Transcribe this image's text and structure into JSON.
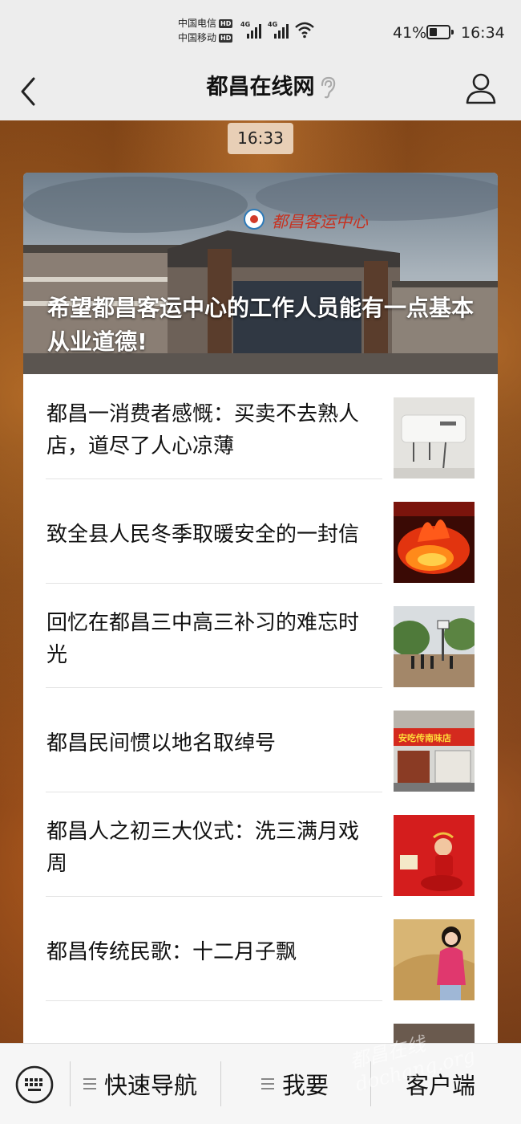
{
  "status_bar": {
    "carrier_1": "中国电信",
    "carrier_2": "中国移动",
    "hd": "HD",
    "net_1": "4G",
    "net_2": "4G",
    "battery_pct": "41%",
    "battery_level": 0.41,
    "time": "16:34"
  },
  "header": {
    "title": "都昌在线网"
  },
  "chat": {
    "timestamp": "16:33"
  },
  "card": {
    "hero_title": "希望都昌客运中心的工作人员能有一点基本从业道德!",
    "hero_sign": "都昌客运中心",
    "items": [
      {
        "title": "都昌一消费者感慨：买卖不去熟人店，道尽了人心凉薄",
        "thumb": "water-heater-photo"
      },
      {
        "title": "致全县人民冬季取暖安全的一封信",
        "thumb": "fire-photo"
      },
      {
        "title": "回忆在都昌三中高三补习的难忘时光",
        "thumb": "schoolyard-photo"
      },
      {
        "title": "都昌民间惯以地名取绰号",
        "thumb": "storefront-photo"
      },
      {
        "title": "都昌人之初三大仪式：洗三满月戏周",
        "thumb": "baby-photo"
      },
      {
        "title": "都昌传统民歌：十二月子飘",
        "thumb": "singer-photo"
      }
    ],
    "store_sign": "安吃传南味店"
  },
  "bottom_bar": {
    "menu_1": "快速导航",
    "menu_2": "我要",
    "menu_3": "客户端"
  },
  "watermark": "都昌在线 dochang.org",
  "colors": {
    "chrome_bg": "#ededed",
    "bottom_bg": "#f6f6f6",
    "timestamp_bg": "#e8cfb6",
    "text": "#111111"
  }
}
